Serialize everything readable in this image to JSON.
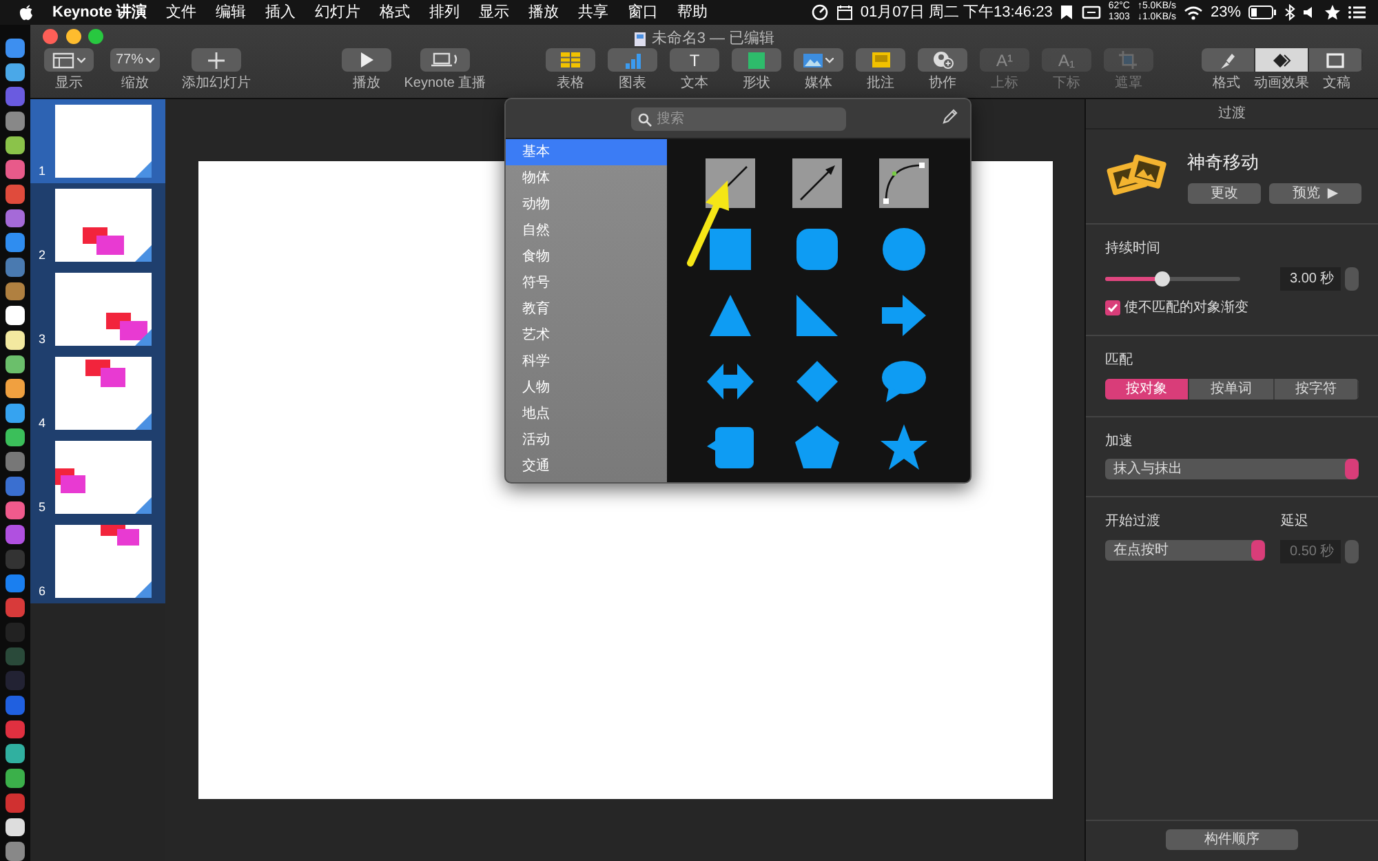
{
  "menu_bar": {
    "app": "Keynote 讲演",
    "menus": [
      "文件",
      "编辑",
      "插入",
      "幻灯片",
      "格式",
      "排列",
      "显示",
      "播放",
      "共享",
      "窗口",
      "帮助"
    ],
    "clock": "01月07日 周二 下午13:46:23",
    "temperature": "62°C",
    "fan": "1303",
    "upload": "↑5.0KB/s",
    "download": "↓1.0KB/s",
    "battery": "23%"
  },
  "window": {
    "title": "未命名3 — 已编辑"
  },
  "toolbar": [
    {
      "kind": "view",
      "label": "显示",
      "disabled": false
    },
    {
      "kind": "zoom",
      "value": "77%",
      "label": "缩放",
      "disabled": false
    },
    {
      "kind": "add",
      "label": "添加幻灯片",
      "disabled": false
    },
    {
      "kind": "play",
      "label": "播放",
      "disabled": false
    },
    {
      "kind": "live",
      "label": "Keynote 直播",
      "disabled": false
    },
    {
      "kind": "table",
      "label": "表格",
      "disabled": false
    },
    {
      "kind": "chart",
      "label": "图表",
      "disabled": false
    },
    {
      "kind": "text",
      "glyph": "T",
      "label": "文本",
      "disabled": false
    },
    {
      "kind": "shape",
      "label": "形状",
      "disabled": false
    },
    {
      "kind": "media",
      "label": "媒体",
      "disabled": false
    },
    {
      "kind": "comment",
      "label": "批注",
      "disabled": false
    },
    {
      "kind": "collab",
      "label": "协作",
      "disabled": false
    },
    {
      "kind": "super",
      "glyph": "A¹",
      "label": "上标",
      "disabled": true
    },
    {
      "kind": "sub",
      "glyph": "A₁",
      "label": "下标",
      "disabled": true
    },
    {
      "kind": "mask",
      "label": "遮罩",
      "disabled": true
    }
  ],
  "inspector_tabs": [
    {
      "kind": "format",
      "label": "格式",
      "selected": false
    },
    {
      "kind": "animate",
      "label": "动画效果",
      "selected": true
    },
    {
      "kind": "document",
      "label": "文稿",
      "selected": false
    }
  ],
  "slides": [
    {
      "number": "1",
      "kind": "blank",
      "selected": true
    },
    {
      "number": "2",
      "kind": "shapes",
      "selected": false
    },
    {
      "number": "3",
      "kind": "shapes",
      "selected": false
    },
    {
      "number": "4",
      "kind": "shapes",
      "selected": false
    },
    {
      "number": "5",
      "kind": "shapes",
      "selected": false
    },
    {
      "number": "6",
      "kind": "shapes",
      "selected": false
    }
  ],
  "shape_picker": {
    "search": {
      "placeholder": "搜索"
    },
    "categories": [
      {
        "label": "基本",
        "selected": true
      },
      {
        "label": "物体",
        "selected": false
      },
      {
        "label": "动物",
        "selected": false
      },
      {
        "label": "自然",
        "selected": false
      },
      {
        "label": "食物",
        "selected": false
      },
      {
        "label": "符号",
        "selected": false
      },
      {
        "label": "教育",
        "selected": false
      },
      {
        "label": "艺术",
        "selected": false
      },
      {
        "label": "科学",
        "selected": false
      },
      {
        "label": "人物",
        "selected": false
      },
      {
        "label": "地点",
        "selected": false
      },
      {
        "label": "活动",
        "selected": false
      },
      {
        "label": "交通",
        "selected": false
      }
    ],
    "shapes": [
      {
        "kind": "line"
      },
      {
        "kind": "arrow-line"
      },
      {
        "kind": "curve"
      },
      {
        "kind": "square"
      },
      {
        "kind": "rounded-square"
      },
      {
        "kind": "circle"
      },
      {
        "kind": "triangle"
      },
      {
        "kind": "right-triangle"
      },
      {
        "kind": "arrow"
      },
      {
        "kind": "double-arrow"
      },
      {
        "kind": "diamond"
      },
      {
        "kind": "speech-bubble"
      },
      {
        "kind": "callout"
      },
      {
        "kind": "pentagon"
      },
      {
        "kind": "star"
      }
    ]
  },
  "inspector": {
    "title": "过渡",
    "transition": {
      "name": "神奇移动",
      "change": "更改",
      "preview": "预览",
      "preview_glyph": "▶"
    },
    "duration": {
      "label": "持续时间",
      "level": 0.42,
      "value": "3.00 秒"
    },
    "fade_option": {
      "label": "使不匹配的对象渐变",
      "checked": true
    },
    "match": {
      "label": "匹配",
      "options": [
        {
          "label": "按对象",
          "selected": true
        },
        {
          "label": "按单词",
          "selected": false
        },
        {
          "label": "按字符",
          "selected": false
        }
      ]
    },
    "acceleration": {
      "label": "加速",
      "value": "抹入与抹出"
    },
    "start": {
      "label": "开始过渡",
      "value": "在点按时"
    },
    "delay": {
      "label": "延迟",
      "value": "0.50 秒",
      "disabled": true
    },
    "build_order": "构件顺序"
  },
  "annotation": {
    "kind": "arrow"
  }
}
